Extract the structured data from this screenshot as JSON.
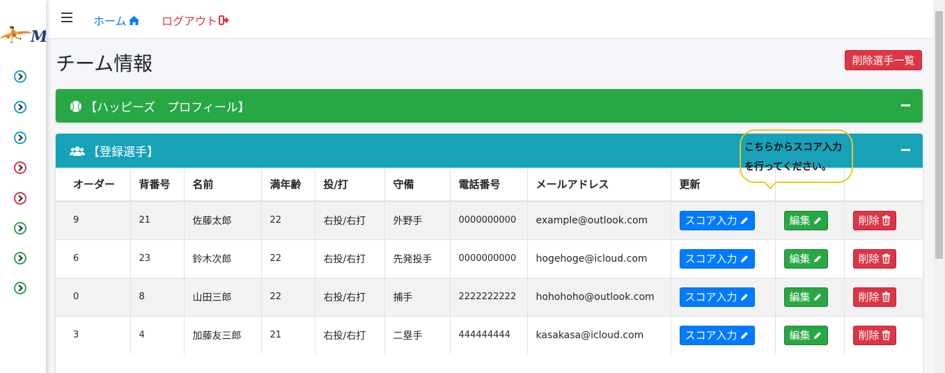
{
  "nav": {
    "home_label": "ホーム",
    "logout_label": "ログアウト"
  },
  "page": {
    "title": "チーム情報",
    "deleted_players_button": "削除選手一覧"
  },
  "profile_card": {
    "title": "【ハッピーズ　プロフィール】"
  },
  "players_card": {
    "title": "【登録選手】"
  },
  "callout": {
    "line1": "こちらからスコア入力",
    "line2": "を行ってください。"
  },
  "table": {
    "headers": [
      "オーダー",
      "背番号",
      "名前",
      "満年齢",
      "投/打",
      "守備",
      "電話番号",
      "メールアドレス",
      "更新",
      "",
      ""
    ],
    "rows": [
      {
        "order": "9",
        "number": "21",
        "name": "佐藤太郎",
        "age": "22",
        "throw_bat": "右投/右打",
        "position": "外野手",
        "phone": "0000000000",
        "email": "example@outlook.com"
      },
      {
        "order": "6",
        "number": "23",
        "name": "鈴木次郎",
        "age": "22",
        "throw_bat": "右投/右打",
        "position": "先発投手",
        "phone": "0000000000",
        "email": "hogehoge@icloud.com"
      },
      {
        "order": "0",
        "number": "8",
        "name": "山田三郎",
        "age": "22",
        "throw_bat": "右投/右打",
        "position": "捕手",
        "phone": "2222222222",
        "email": "hohohoho@outlook.com"
      },
      {
        "order": "3",
        "number": "4",
        "name": "加藤友三郎",
        "age": "21",
        "throw_bat": "右投/右打",
        "position": "二塁手",
        "phone": "444444444",
        "email": "kasakasa@icloud.com"
      }
    ],
    "score_button": "スコア入力",
    "edit_button": "編集",
    "delete_button": "削除"
  },
  "sidebar": {
    "icons": [
      {
        "name": "chevron-circle-icon",
        "color": "#17a2b8"
      },
      {
        "name": "chevron-circle-icon",
        "color": "#17a2b8"
      },
      {
        "name": "chevron-circle-icon",
        "color": "#17a2b8"
      },
      {
        "name": "chevron-circle-icon",
        "color": "#dc3545"
      },
      {
        "name": "chevron-circle-icon",
        "color": "#dc3545"
      },
      {
        "name": "chevron-circle-icon",
        "color": "#28a745"
      },
      {
        "name": "chevron-circle-icon",
        "color": "#28a745"
      },
      {
        "name": "chevron-circle-icon",
        "color": "#28a745"
      }
    ]
  },
  "colors": {
    "primary": "#007bff",
    "success": "#28a745",
    "info": "#17a2b8",
    "danger": "#dc3545",
    "callout_border": "#f0c419"
  }
}
